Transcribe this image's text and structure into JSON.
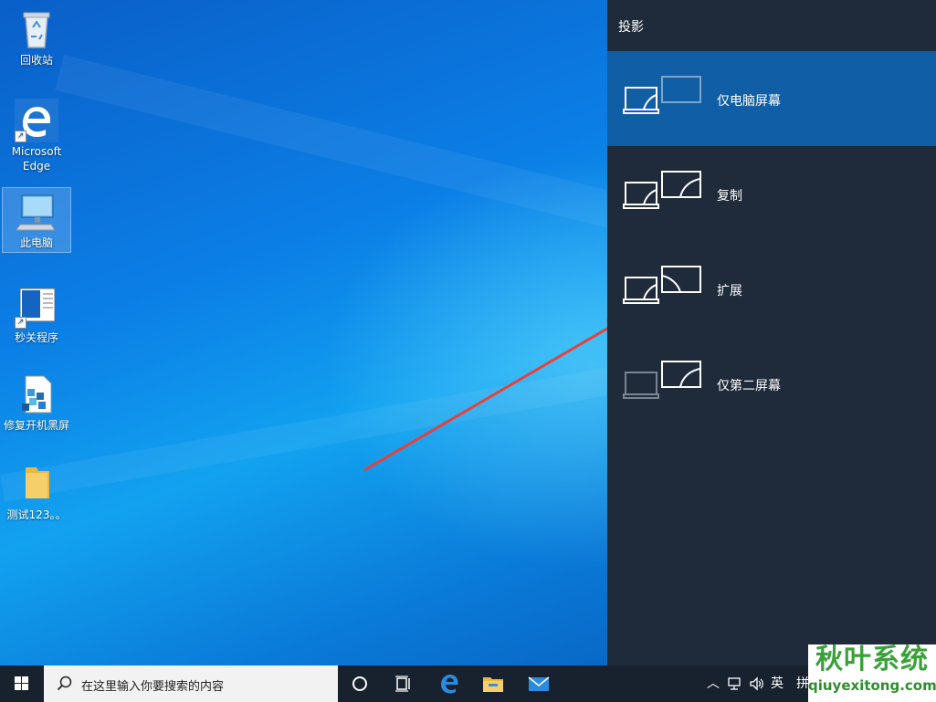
{
  "desktop": {
    "icons": [
      {
        "label": "回收站",
        "icon": "recycle-bin-icon"
      },
      {
        "label": "Microsoft Edge",
        "icon": "edge-icon"
      },
      {
        "label": "此电脑",
        "icon": "this-pc-icon"
      },
      {
        "label": "秒关程序",
        "icon": "program-icon"
      },
      {
        "label": "修复开机黑屏",
        "icon": "repair-icon"
      },
      {
        "label": "测试123。。",
        "icon": "folder-icon"
      }
    ]
  },
  "project_panel": {
    "title": "投影",
    "options": [
      {
        "label": "仅电脑屏幕",
        "icon": "pc-screen-only-icon",
        "selected": true
      },
      {
        "label": "复制",
        "icon": "duplicate-icon",
        "selected": false
      },
      {
        "label": "扩展",
        "icon": "extend-icon",
        "selected": false
      },
      {
        "label": "仅第二屏幕",
        "icon": "second-screen-only-icon",
        "selected": false
      }
    ]
  },
  "taskbar": {
    "search_placeholder": "在这里输入你要搜索的内容",
    "ime_label": "英",
    "ime_label2": "拼"
  },
  "watermark": {
    "title": "秋叶系统",
    "url": "qiuyexitong.com"
  },
  "colors": {
    "panel_bg": "#1f2a3a",
    "selected_bg": "#0f5ea6",
    "taskbar_bg": "#18222f",
    "arrow": "#e8403a"
  }
}
